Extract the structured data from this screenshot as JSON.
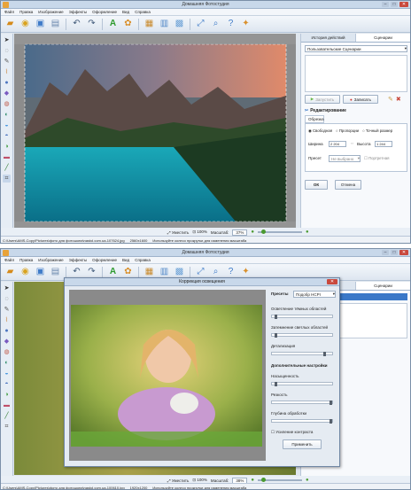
{
  "win1": {
    "title": "Домашняя Фотостудия",
    "menu": [
      "Файл",
      "Правка",
      "Изображение",
      "Эффекты",
      "Оформление",
      "Вид",
      "Справка"
    ],
    "panel": {
      "tabs": [
        "История действий",
        "Сценарии"
      ],
      "scenario_select": "Пользовательские Сценарии",
      "run_button": "Запустить",
      "record_button": "Записать",
      "section_title": "Редактирование",
      "subsection": "Обрезка",
      "radios": [
        "Свободная",
        "Пропорции",
        "Точный размер"
      ],
      "width_label": "Ширина",
      "width_value": "2 204",
      "height_label": "Высота",
      "height_value": "1 244",
      "preset_label": "Пресет",
      "preset_value": "Не выбрано",
      "portrait_label": "Портретная",
      "ok_button": "ОК",
      "cancel_button": "Отмена"
    },
    "zoom": {
      "fit": "Уместить",
      "percent100": "100%",
      "label": "Масштаб:",
      "value": "37%"
    },
    "status": {
      "path": "C:\\Users\\AMS-Copy\\Pictures\\фото для фотошопа\\nastol.com.ua-107624.jpg",
      "size": "2560x1600",
      "hint": "Используйте колесо прокрутки для изменения масштаба"
    }
  },
  "win2": {
    "title": "Домашняя Фотостудия",
    "menu": [
      "Файл",
      "Правка",
      "Изображение",
      "Эффекты",
      "Оформление",
      "Вид",
      "Справка"
    ],
    "panel_tab": "Сценарии",
    "dialog": {
      "title": "Коррекция освещения",
      "presets_label": "Пресеты",
      "presets_value": "Подобр HCPI",
      "slider_labels": [
        "Осветление тёмных областей",
        "Затемнение светлых областей",
        "Детализация"
      ],
      "advanced_title": "Дополнительные настройки",
      "adv_labels": [
        "Насыщенность",
        "Резкость",
        "Глубина обработки"
      ],
      "checkbox": "Усиление контраста",
      "apply_button": "Применить"
    },
    "zoom": {
      "fit": "Уместить",
      "percent100": "100%",
      "label": "Масштаб:",
      "value": "38%"
    },
    "status": {
      "path": "C:\\Users\\AMS-Copy\\Pictures\\фото для фотошопа\\nastol.com.ua-100610.jpg",
      "size": "1920x1200",
      "hint": "Используйте колесо прокрутки для изменения масштаба"
    }
  },
  "slider_levels": {
    "s1": 0.05,
    "s2": 0.05,
    "s3": 0.85,
    "a1": 0.05,
    "a2": 0.95,
    "a3": 0.95
  }
}
